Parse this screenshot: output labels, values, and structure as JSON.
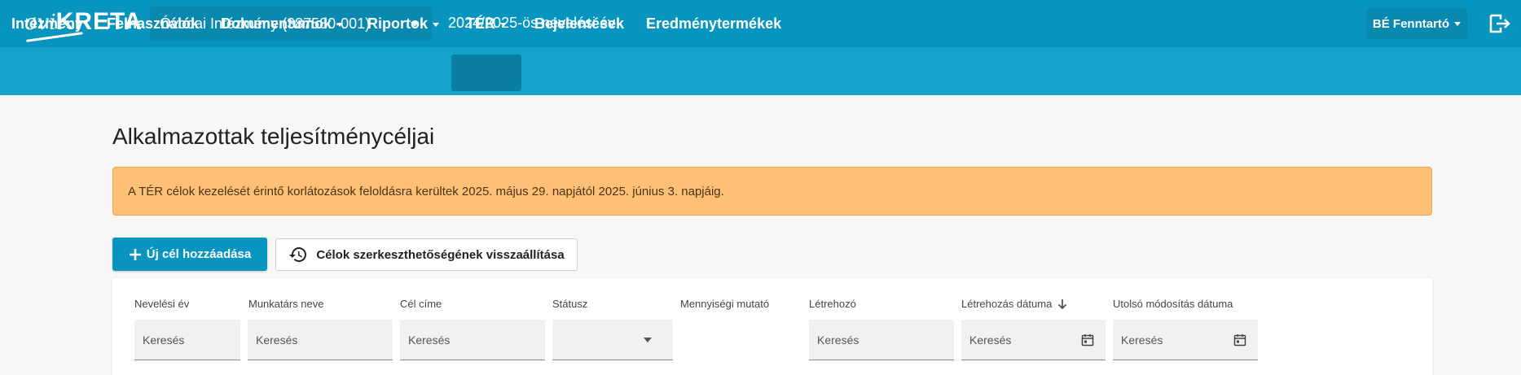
{
  "header": {
    "logo_ovi": "ovi",
    "logo_kreta": "KRETA",
    "institution_select": "Óvodai Intézmény (387580-001)",
    "school_year": "2024/2025-ös nevelési év",
    "user_menu": "BÉ Fenntartó",
    "logout_icon": "logout-icon"
  },
  "nav": {
    "items": [
      {
        "label": "Intézmény"
      },
      {
        "label": "Felhasználók"
      },
      {
        "label": "Dokumentumok"
      },
      {
        "label": "Riportok"
      },
      {
        "label": "TÉR"
      },
      {
        "label": "Bejelentések"
      },
      {
        "label": "Eredménytermékek"
      }
    ],
    "active": "TÉR"
  },
  "page": {
    "title": "Alkalmazottak teljesítménycéljai",
    "alert": "A TÉR célok kezelését érintő korlátozások feloldásra kerültek 2025. május 29. napjától 2025. június 3. napjáig.",
    "add_button": "Új cél hozzáadása",
    "restore_button": "Célok szerkeszthetőségének visszaállítása"
  },
  "table": {
    "columns": [
      {
        "label": "Nevelési év",
        "placeholder": "Keresés"
      },
      {
        "label": "Munkatárs neve",
        "placeholder": "Keresés"
      },
      {
        "label": "Cél címe",
        "placeholder": "Keresés"
      },
      {
        "label": "Státusz",
        "placeholder": ""
      },
      {
        "label": "Mennyiségi mutató",
        "placeholder": ""
      },
      {
        "label": "Létrehozó",
        "placeholder": "Keresés"
      },
      {
        "label": "Létrehozás dátuma",
        "placeholder": "Keresés"
      },
      {
        "label": "Utolsó módosítás dátuma",
        "placeholder": "Keresés"
      }
    ],
    "sort_column": "Létrehozás dátuma",
    "sort_direction": "descending"
  },
  "colors": {
    "topbar": "#0795bf",
    "navbar": "#12a4cd",
    "alert_bg": "#fdc076",
    "primary": "#0a95c0"
  }
}
